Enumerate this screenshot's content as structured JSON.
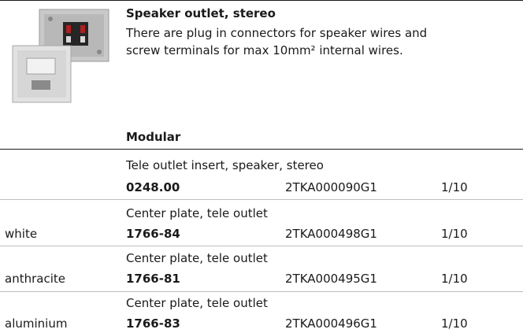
{
  "product": {
    "title": "Speaker outlet, stereo",
    "description_lines": [
      "There are plug in connectors for speaker wires and",
      "screw terminals for max 10mm² internal wires."
    ]
  },
  "section_title": "Modular",
  "rows": [
    {
      "color": "",
      "description": "Tele outlet insert, speaker, stereo",
      "type_no": "0248.00",
      "order_no": "2TKA000090G1",
      "pack": "1/10"
    },
    {
      "color": "white",
      "description": "Center plate, tele outlet",
      "type_no": "1766-84",
      "order_no": "2TKA000498G1",
      "pack": "1/10"
    },
    {
      "color": "anthracite",
      "description": "Center plate, tele outlet",
      "type_no": "1766-81",
      "order_no": "2TKA000495G1",
      "pack": "1/10"
    },
    {
      "color": "aluminium",
      "description": "Center plate, tele outlet",
      "type_no": "1766-83",
      "order_no": "2TKA000496G1",
      "pack": "1/10"
    }
  ]
}
